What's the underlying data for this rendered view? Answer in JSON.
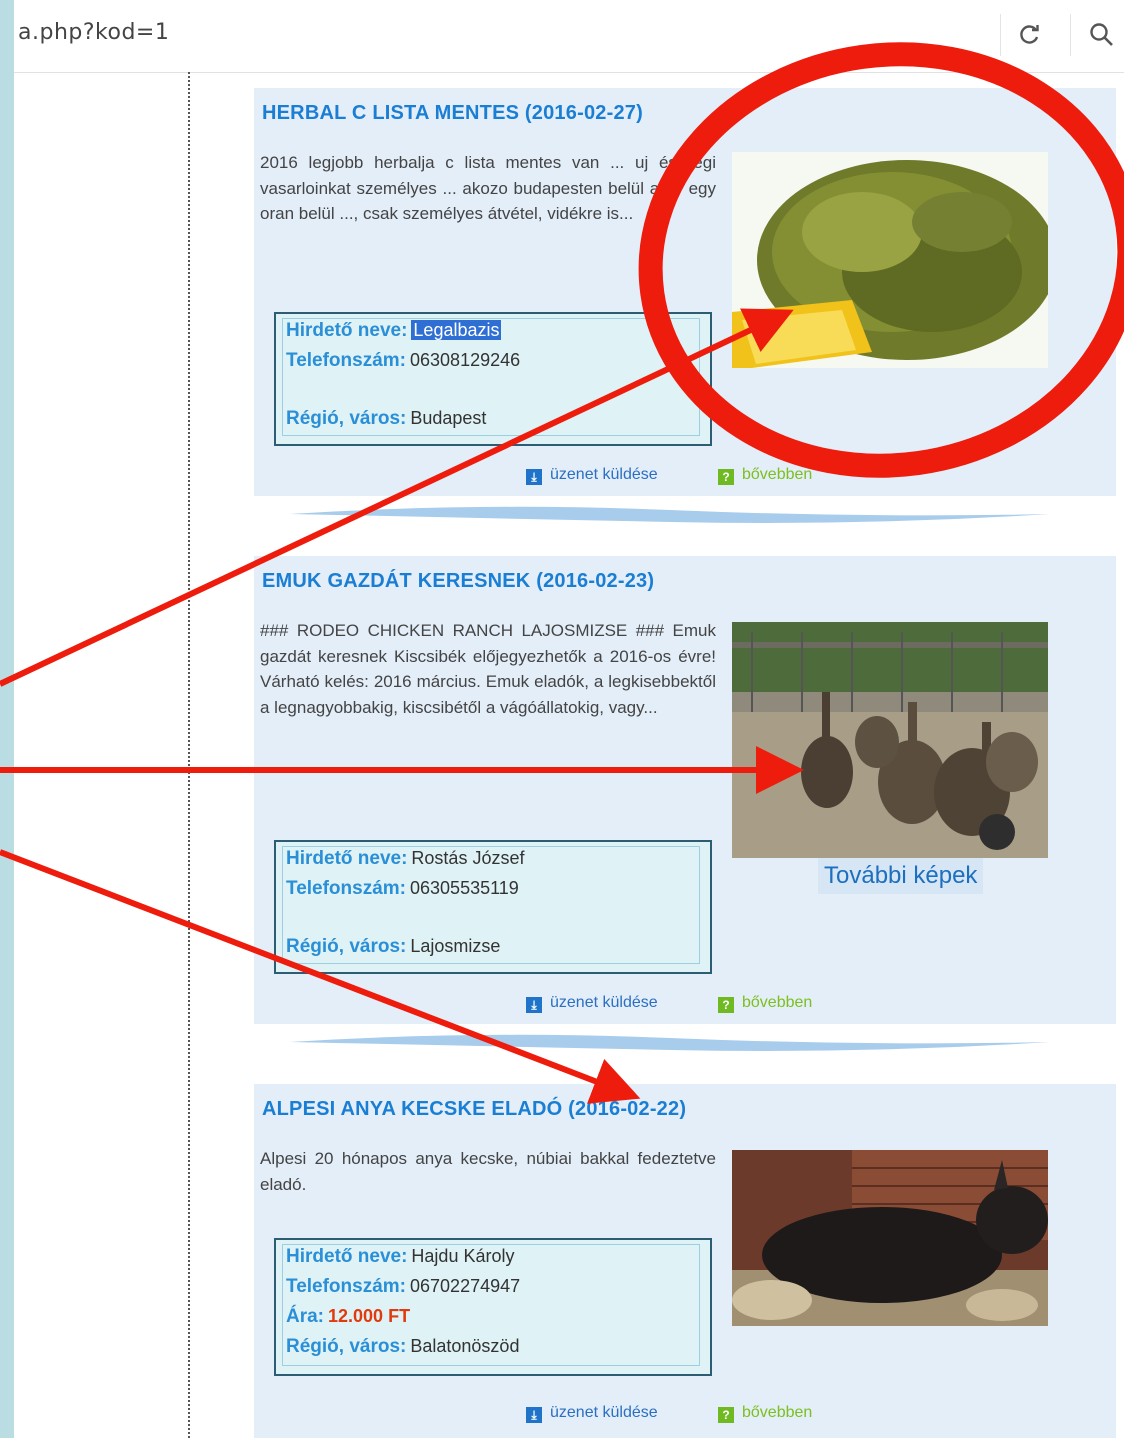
{
  "browser": {
    "url": "a.php?kod=1",
    "reload_icon": "reload-icon",
    "search_icon": "search-icon"
  },
  "ads": [
    {
      "title": "HERBAL C LISTA MENTES (2016-02-27)",
      "description": "2016 legjobb herbalja c lista mentes van ... uj és régi vasarloinkat személyes ... akozo budapesten belül akar egy oran belül ..., csak személyes átvétel, vidékre is...",
      "contact": {
        "advertiser_label": "Hirdető neve:",
        "advertiser_value": "Legalbazis",
        "phone_label": "Telefonszám:",
        "phone_value": "06308129246",
        "region_label": "Régió, város:",
        "region_value": "Budapest"
      },
      "image": "herbal-leaves-image"
    },
    {
      "title": "EMUK GAZDÁT KERESNEK (2016-02-23)",
      "description": "### RODEO CHICKEN RANCH LAJOSMIZSE ### Emuk gazdát keresnek Kiscsibék előjegyezhetők a 2016-os évre! Várható kelés: 2016 március. Emuk eladók, a legkisebbektől a legnagyobbakig, kiscsibétől a vágóállatokig, vagy...",
      "contact": {
        "advertiser_label": "Hirdető neve:",
        "advertiser_value": "Rostás József",
        "phone_label": "Telefonszám:",
        "phone_value": "06305535119",
        "region_label": "Régió, város:",
        "region_value": "Lajosmizse"
      },
      "image": "emus-image",
      "more_pics": "További képek"
    },
    {
      "title": "ALPESI ANYA KECSKE ELADÓ (2016-02-22)",
      "description": "Alpesi 20 hónapos anya kecske, núbiai bakkal fedeztetve eladó.",
      "contact": {
        "advertiser_label": "Hirdető neve:",
        "advertiser_value": "Hajdu Károly",
        "phone_label": "Telefonszám:",
        "phone_value": "06702274947",
        "price_label": "Ára:",
        "price_value": "12.000 FT",
        "region_label": "Régió, város:",
        "region_value": "Balatonöszöd"
      },
      "image": "goat-image"
    }
  ],
  "actions": {
    "send_message": "üzenet küldése",
    "more": "bővebben"
  },
  "annotation": {
    "color": "#ee1c0c"
  }
}
